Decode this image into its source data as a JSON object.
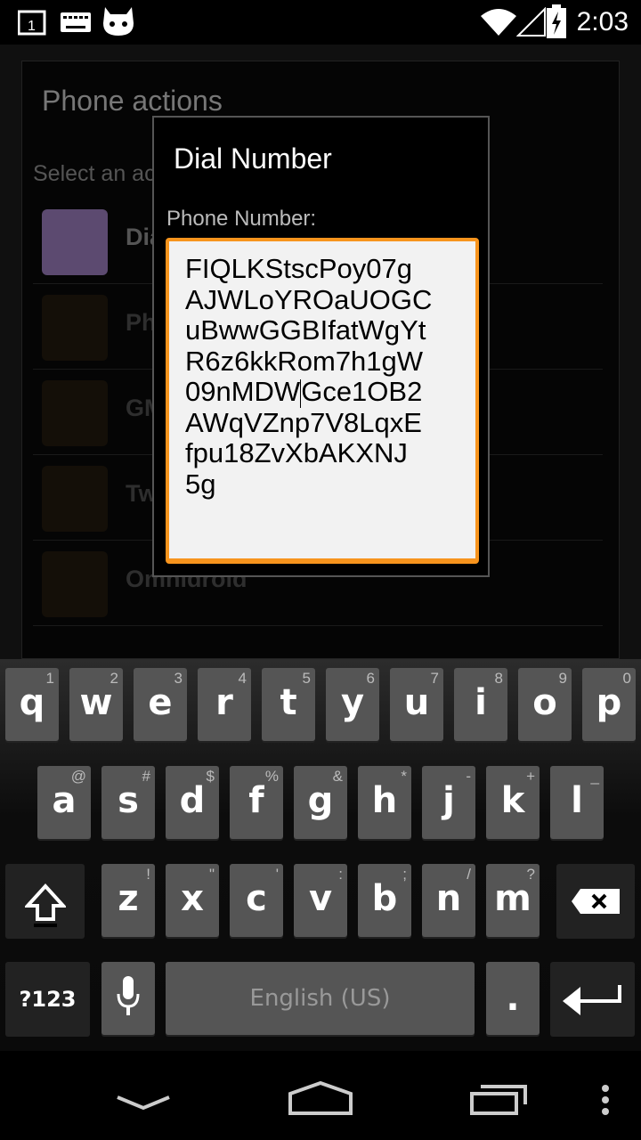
{
  "status_bar": {
    "time": "2:03",
    "icons": [
      "notification-1-icon",
      "keyboard-icon",
      "cyanogen-icon",
      "wifi-icon",
      "signal-icon",
      "battery-charging-icon"
    ],
    "notification_count": "1"
  },
  "background_dialog": {
    "title": "Phone actions",
    "prompt": "Select an action of [Phone] to use:",
    "items": [
      "Dial Number",
      "Phone",
      "GMail",
      "Twitter",
      "Omnidroid"
    ]
  },
  "dialog": {
    "title": "Dial Number",
    "field_label": "Phone Number:",
    "value_before_cursor": "FIQLKStscPoy07g\nAJWLoYROaUOGC\nuBwwGGBIfatWgYt\nR6z6kkRom7h1gW\n09nMDW",
    "value_after_cursor": "Gce1OB2\nAWqVZnp7V8LqxE\nfpu18ZvXbAKXNJ\n5g",
    "accent_color": "#f7941d"
  },
  "keyboard": {
    "row1": [
      {
        "k": "q",
        "h": "1"
      },
      {
        "k": "w",
        "h": "2"
      },
      {
        "k": "e",
        "h": "3"
      },
      {
        "k": "r",
        "h": "4"
      },
      {
        "k": "t",
        "h": "5"
      },
      {
        "k": "y",
        "h": "6"
      },
      {
        "k": "u",
        "h": "7"
      },
      {
        "k": "i",
        "h": "8"
      },
      {
        "k": "o",
        "h": "9"
      },
      {
        "k": "p",
        "h": "0"
      }
    ],
    "row2": [
      {
        "k": "a",
        "h": "@"
      },
      {
        "k": "s",
        "h": "#"
      },
      {
        "k": "d",
        "h": "$"
      },
      {
        "k": "f",
        "h": "%"
      },
      {
        "k": "g",
        "h": "&"
      },
      {
        "k": "h",
        "h": "*"
      },
      {
        "k": "j",
        "h": "-"
      },
      {
        "k": "k",
        "h": "+"
      },
      {
        "k": "l",
        "h": "_"
      }
    ],
    "row3": [
      {
        "k": "z",
        "h": "!"
      },
      {
        "k": "x",
        "h": "\""
      },
      {
        "k": "c",
        "h": "'"
      },
      {
        "k": "v",
        "h": ":"
      },
      {
        "k": "b",
        "h": ";"
      },
      {
        "k": "n",
        "h": "/"
      },
      {
        "k": "m",
        "h": "?"
      }
    ],
    "symbols_label": "?123",
    "space_label": "English (US)",
    "period_label": "."
  },
  "nav": [
    "back-icon",
    "home-icon",
    "recents-icon",
    "menu-icon"
  ]
}
